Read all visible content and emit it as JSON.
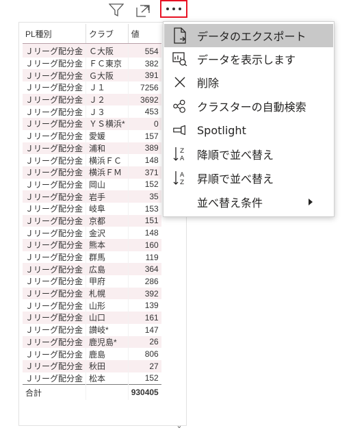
{
  "table": {
    "headers": [
      "PL種別",
      "クラブ",
      "値"
    ],
    "rows": [
      [
        "Ｊリーグ配分金",
        "Ｃ大阪",
        "554"
      ],
      [
        "Ｊリーグ配分金",
        "ＦＣ東京",
        "382"
      ],
      [
        "Ｊリーグ配分金",
        "Ｇ大阪",
        "391"
      ],
      [
        "Ｊリーグ配分金",
        "Ｊ１",
        "7256"
      ],
      [
        "Ｊリーグ配分金",
        "Ｊ２",
        "3692"
      ],
      [
        "Ｊリーグ配分金",
        "Ｊ３",
        "453"
      ],
      [
        "Ｊリーグ配分金",
        "ＹＳ横浜*",
        "0"
      ],
      [
        "Ｊリーグ配分金",
        "愛媛",
        "157"
      ],
      [
        "Ｊリーグ配分金",
        "浦和",
        "389"
      ],
      [
        "Ｊリーグ配分金",
        "横浜ＦＣ",
        "148"
      ],
      [
        "Ｊリーグ配分金",
        "横浜ＦＭ",
        "371"
      ],
      [
        "Ｊリーグ配分金",
        "岡山",
        "152"
      ],
      [
        "Ｊリーグ配分金",
        "岩手",
        "35"
      ],
      [
        "Ｊリーグ配分金",
        "岐阜",
        "153"
      ],
      [
        "Ｊリーグ配分金",
        "京都",
        "151"
      ],
      [
        "Ｊリーグ配分金",
        "金沢",
        "148"
      ],
      [
        "Ｊリーグ配分金",
        "熊本",
        "160"
      ],
      [
        "Ｊリーグ配分金",
        "群馬",
        "119"
      ],
      [
        "Ｊリーグ配分金",
        "広島",
        "364"
      ],
      [
        "Ｊリーグ配分金",
        "甲府",
        "286"
      ],
      [
        "Ｊリーグ配分金",
        "札幌",
        "392"
      ],
      [
        "Ｊリーグ配分金",
        "山形",
        "139"
      ],
      [
        "Ｊリーグ配分金",
        "山口",
        "161"
      ],
      [
        "Ｊリーグ配分金",
        "讃岐*",
        "147"
      ],
      [
        "Ｊリーグ配分金",
        "鹿児島*",
        "26"
      ],
      [
        "Ｊリーグ配分金",
        "鹿島",
        "806"
      ],
      [
        "Ｊリーグ配分金",
        "秋田",
        "27"
      ],
      [
        "Ｊリーグ配分金",
        "松本",
        "152"
      ]
    ],
    "total_label": "合計",
    "total_value": "930405"
  },
  "menu": {
    "items": [
      {
        "label": "データのエクスポート",
        "icon": "export-icon"
      },
      {
        "label": "データを表示します",
        "icon": "show-data-icon"
      },
      {
        "label": "削除",
        "icon": "close-icon"
      },
      {
        "label": "クラスターの自動検索",
        "icon": "cluster-icon"
      },
      {
        "label": "Spotlight",
        "icon": "spotlight-icon"
      },
      {
        "label": "降順で並べ替え",
        "icon": "sort-descending-icon"
      },
      {
        "label": "昇順で並べ替え",
        "icon": "sort-ascending-icon"
      },
      {
        "label": "並べ替え条件",
        "icon": "chevron-right-icon"
      }
    ]
  },
  "header_icons": [
    "filter-icon",
    "focus-mode-icon",
    "more-options-icon"
  ],
  "colors": {
    "highlight_border": "#e81123",
    "row_alt": "#f9eef0",
    "menu_hover": "#c8c8c8"
  }
}
